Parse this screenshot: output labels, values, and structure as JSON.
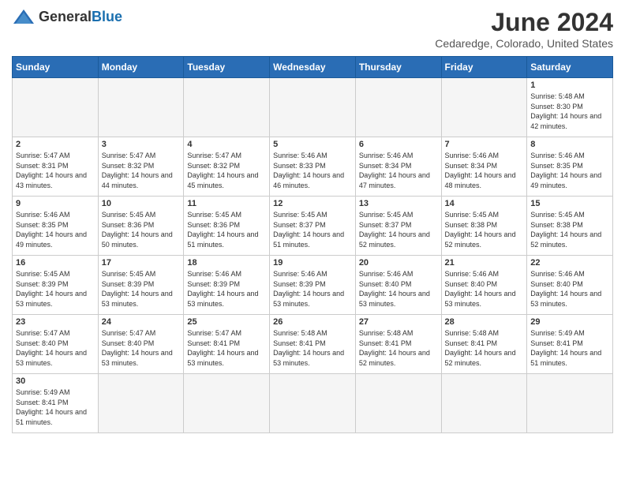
{
  "header": {
    "logo_general": "General",
    "logo_blue": "Blue",
    "month_title": "June 2024",
    "location": "Cedaredge, Colorado, United States"
  },
  "weekdays": [
    "Sunday",
    "Monday",
    "Tuesday",
    "Wednesday",
    "Thursday",
    "Friday",
    "Saturday"
  ],
  "weeks": [
    [
      {
        "day": "",
        "empty": true
      },
      {
        "day": "",
        "empty": true
      },
      {
        "day": "",
        "empty": true
      },
      {
        "day": "",
        "empty": true
      },
      {
        "day": "",
        "empty": true
      },
      {
        "day": "",
        "empty": true
      },
      {
        "day": "1",
        "sunrise": "5:48 AM",
        "sunset": "8:30 PM",
        "daylight": "14 hours and 42 minutes."
      }
    ],
    [
      {
        "day": "2",
        "sunrise": "5:47 AM",
        "sunset": "8:31 PM",
        "daylight": "14 hours and 43 minutes."
      },
      {
        "day": "3",
        "sunrise": "5:47 AM",
        "sunset": "8:32 PM",
        "daylight": "14 hours and 44 minutes."
      },
      {
        "day": "4",
        "sunrise": "5:47 AM",
        "sunset": "8:32 PM",
        "daylight": "14 hours and 45 minutes."
      },
      {
        "day": "5",
        "sunrise": "5:46 AM",
        "sunset": "8:33 PM",
        "daylight": "14 hours and 46 minutes."
      },
      {
        "day": "6",
        "sunrise": "5:46 AM",
        "sunset": "8:34 PM",
        "daylight": "14 hours and 47 minutes."
      },
      {
        "day": "7",
        "sunrise": "5:46 AM",
        "sunset": "8:34 PM",
        "daylight": "14 hours and 48 minutes."
      },
      {
        "day": "8",
        "sunrise": "5:46 AM",
        "sunset": "8:35 PM",
        "daylight": "14 hours and 49 minutes."
      }
    ],
    [
      {
        "day": "9",
        "sunrise": "5:46 AM",
        "sunset": "8:35 PM",
        "daylight": "14 hours and 49 minutes."
      },
      {
        "day": "10",
        "sunrise": "5:45 AM",
        "sunset": "8:36 PM",
        "daylight": "14 hours and 50 minutes."
      },
      {
        "day": "11",
        "sunrise": "5:45 AM",
        "sunset": "8:36 PM",
        "daylight": "14 hours and 51 minutes."
      },
      {
        "day": "12",
        "sunrise": "5:45 AM",
        "sunset": "8:37 PM",
        "daylight": "14 hours and 51 minutes."
      },
      {
        "day": "13",
        "sunrise": "5:45 AM",
        "sunset": "8:37 PM",
        "daylight": "14 hours and 52 minutes."
      },
      {
        "day": "14",
        "sunrise": "5:45 AM",
        "sunset": "8:38 PM",
        "daylight": "14 hours and 52 minutes."
      },
      {
        "day": "15",
        "sunrise": "5:45 AM",
        "sunset": "8:38 PM",
        "daylight": "14 hours and 52 minutes."
      }
    ],
    [
      {
        "day": "16",
        "sunrise": "5:45 AM",
        "sunset": "8:39 PM",
        "daylight": "14 hours and 53 minutes."
      },
      {
        "day": "17",
        "sunrise": "5:45 AM",
        "sunset": "8:39 PM",
        "daylight": "14 hours and 53 minutes."
      },
      {
        "day": "18",
        "sunrise": "5:46 AM",
        "sunset": "8:39 PM",
        "daylight": "14 hours and 53 minutes."
      },
      {
        "day": "19",
        "sunrise": "5:46 AM",
        "sunset": "8:39 PM",
        "daylight": "14 hours and 53 minutes."
      },
      {
        "day": "20",
        "sunrise": "5:46 AM",
        "sunset": "8:40 PM",
        "daylight": "14 hours and 53 minutes."
      },
      {
        "day": "21",
        "sunrise": "5:46 AM",
        "sunset": "8:40 PM",
        "daylight": "14 hours and 53 minutes."
      },
      {
        "day": "22",
        "sunrise": "5:46 AM",
        "sunset": "8:40 PM",
        "daylight": "14 hours and 53 minutes."
      }
    ],
    [
      {
        "day": "23",
        "sunrise": "5:47 AM",
        "sunset": "8:40 PM",
        "daylight": "14 hours and 53 minutes."
      },
      {
        "day": "24",
        "sunrise": "5:47 AM",
        "sunset": "8:40 PM",
        "daylight": "14 hours and 53 minutes."
      },
      {
        "day": "25",
        "sunrise": "5:47 AM",
        "sunset": "8:41 PM",
        "daylight": "14 hours and 53 minutes."
      },
      {
        "day": "26",
        "sunrise": "5:48 AM",
        "sunset": "8:41 PM",
        "daylight": "14 hours and 53 minutes."
      },
      {
        "day": "27",
        "sunrise": "5:48 AM",
        "sunset": "8:41 PM",
        "daylight": "14 hours and 52 minutes."
      },
      {
        "day": "28",
        "sunrise": "5:48 AM",
        "sunset": "8:41 PM",
        "daylight": "14 hours and 52 minutes."
      },
      {
        "day": "29",
        "sunrise": "5:49 AM",
        "sunset": "8:41 PM",
        "daylight": "14 hours and 51 minutes."
      }
    ],
    [
      {
        "day": "30",
        "sunrise": "5:49 AM",
        "sunset": "8:41 PM",
        "daylight": "14 hours and 51 minutes."
      },
      {
        "day": "",
        "empty": true
      },
      {
        "day": "",
        "empty": true
      },
      {
        "day": "",
        "empty": true
      },
      {
        "day": "",
        "empty": true
      },
      {
        "day": "",
        "empty": true
      },
      {
        "day": "",
        "empty": true
      }
    ]
  ]
}
